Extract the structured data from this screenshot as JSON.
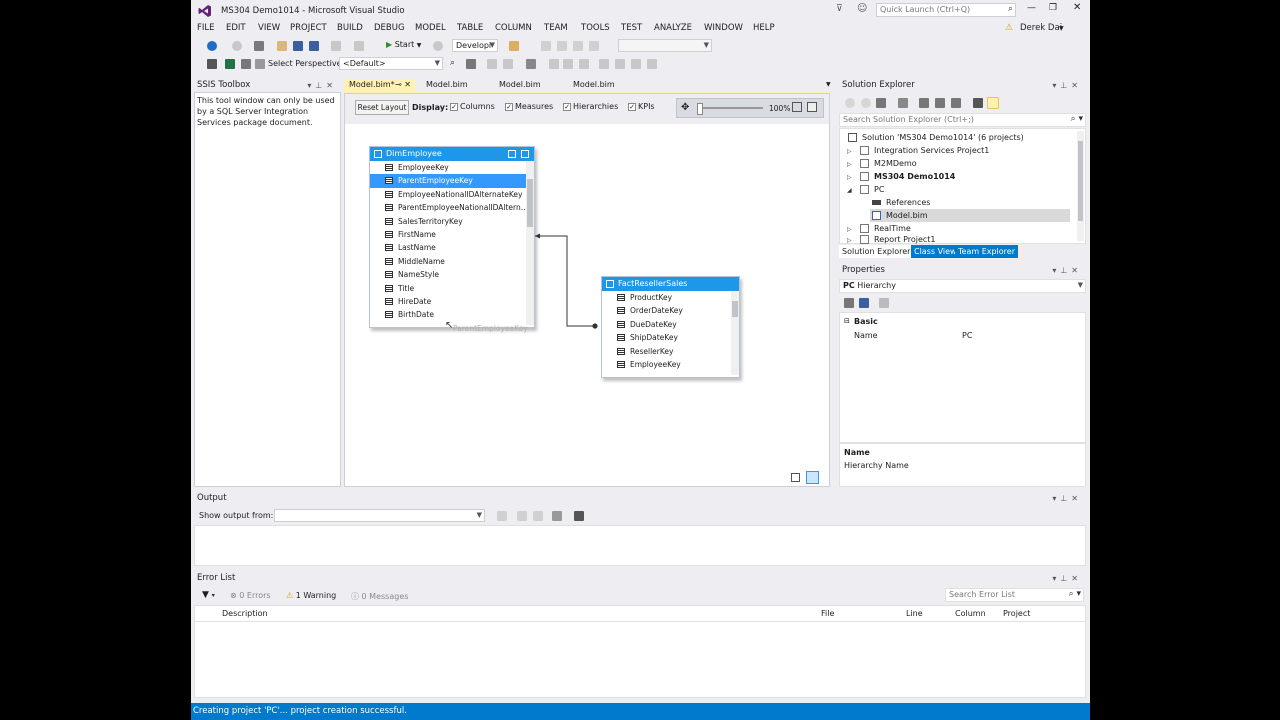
{
  "window": {
    "title": "MS304 Demo1014 - Microsoft Visual Studio",
    "quick_launch_placeholder": "Quick Launch (Ctrl+Q)",
    "user": "Derek Dai"
  },
  "menu": [
    "FILE",
    "EDIT",
    "VIEW",
    "PROJECT",
    "BUILD",
    "DEBUG",
    "MODEL",
    "TABLE",
    "COLUMN",
    "TEAM",
    "TOOLS",
    "TEST",
    "ANALYZE",
    "WINDOW",
    "HELP"
  ],
  "toolbar": {
    "start_label": "Start",
    "config_value": "Developi",
    "perspective_label": "Select Perspective",
    "perspective_value": "<Default>"
  },
  "ssis_toolbox": {
    "title": "SSIS Toolbox",
    "message": "This tool window can only be used by a SQL Server Integration Services package document."
  },
  "doc_tabs": [
    {
      "label": "Model.bim*",
      "active": true
    },
    {
      "label": "Model.bim"
    },
    {
      "label": "Model.bim"
    },
    {
      "label": "Model.bim"
    }
  ],
  "designer": {
    "reset_layout": "Reset Layout",
    "display_label": "Display:",
    "options": [
      "Columns",
      "Measures",
      "Hierarchies",
      "KPIs"
    ],
    "zoom": "100%",
    "drag_hint": "ParentEmployeeKey"
  },
  "tables": {
    "dim_employee": {
      "name": "DimEmployee",
      "columns": [
        "EmployeeKey",
        "ParentEmployeeKey",
        "EmployeeNationalIDAlternateKey",
        "ParentEmployeeNationalIDAltern...",
        "SalesTerritoryKey",
        "FirstName",
        "LastName",
        "MiddleName",
        "NameStyle",
        "Title",
        "HireDate",
        "BirthDate"
      ],
      "selected_index": 1
    },
    "fact_reseller_sales": {
      "name": "FactResellerSales",
      "columns": [
        "ProductKey",
        "OrderDateKey",
        "DueDateKey",
        "ShipDateKey",
        "ResellerKey",
        "EmployeeKey"
      ]
    }
  },
  "solution_explorer": {
    "title": "Solution Explorer",
    "search_placeholder": "Search Solution Explorer (Ctrl+;)",
    "items": [
      "Solution 'MS304 Demo1014' (6 projects)",
      "Integration Services Project1",
      "M2MDemo",
      "MS304 Demo1014",
      "PC",
      "References",
      "Model.bim",
      "RealTime",
      "Report Project1"
    ],
    "bottom_tabs": [
      "Solution Explorer",
      "Class View",
      "Team Explorer"
    ]
  },
  "properties": {
    "title": "Properties",
    "object": "PC",
    "object_type": "Hierarchy",
    "category": "Basic",
    "rows": [
      {
        "name": "Name",
        "value": "PC"
      }
    ],
    "desc_title": "Name",
    "desc_text": "Hierarchy Name"
  },
  "output": {
    "title": "Output",
    "show_from_label": "Show output from:"
  },
  "error_list": {
    "title": "Error List",
    "errors": "0 Errors",
    "warnings": "1 Warning",
    "messages": "0 Messages",
    "search_placeholder": "Search Error List",
    "columns": [
      "Description",
      "File",
      "Line",
      "Column",
      "Project"
    ]
  },
  "status": "Creating project 'PC'... project creation successful.",
  "colors": {
    "accent": "#007acc",
    "selection": "#3399ff",
    "table_header": "#1c97ea",
    "active_tab": "#fff1b4"
  }
}
